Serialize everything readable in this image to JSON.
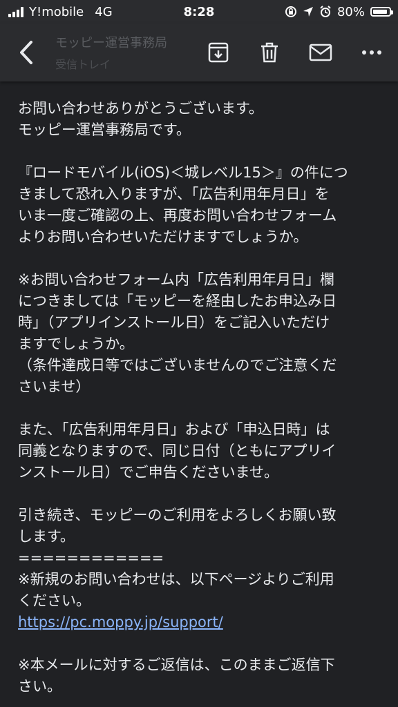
{
  "status": {
    "carrier": "Y!mobile",
    "network": "4G",
    "time": "8:28",
    "battery": "80%"
  },
  "toolbar": {
    "subject_ghost": "モッピー運営事務局",
    "subject_ghost2": "受信トレイ"
  },
  "email": {
    "lines": [
      "お問い合わせありがとうございます。",
      "モッピー運営事務局です。",
      "",
      "『ロードモバイル(iOS)＜城レベル15＞』の件につ",
      "きまして恐れ入りますが、「広告利用年月日」を",
      "いま一度ご確認の上、再度お問い合わせフォーム",
      "よりお問い合わせいただけますでしょうか。",
      "",
      "※お問い合わせフォーム内「広告利用年月日」欄",
      "につきましては「モッピーを経由したお申込み日",
      "時」（アプリインストール日）をご記入いただけ",
      "ますでしょうか。",
      "（条件達成日等ではございませんのでご注意くだ",
      "さいませ）",
      "",
      "また、「広告利用年月日」および「申込日時」は",
      "同義となりますので、同じ日付（ともにアプリイ",
      "ンストール日）でご申告くださいませ。",
      "",
      "引き続き、モッピーのご利用をよろしくお願い致",
      "します。",
      "============",
      "※新規のお問い合わせは、以下ページよりご利用",
      "ください。"
    ],
    "link": "https://pc.moppy.jp/support/",
    "footer_lines": [
      "",
      "※本メールに対するご返信は、このままご返信下",
      "さい。"
    ]
  }
}
